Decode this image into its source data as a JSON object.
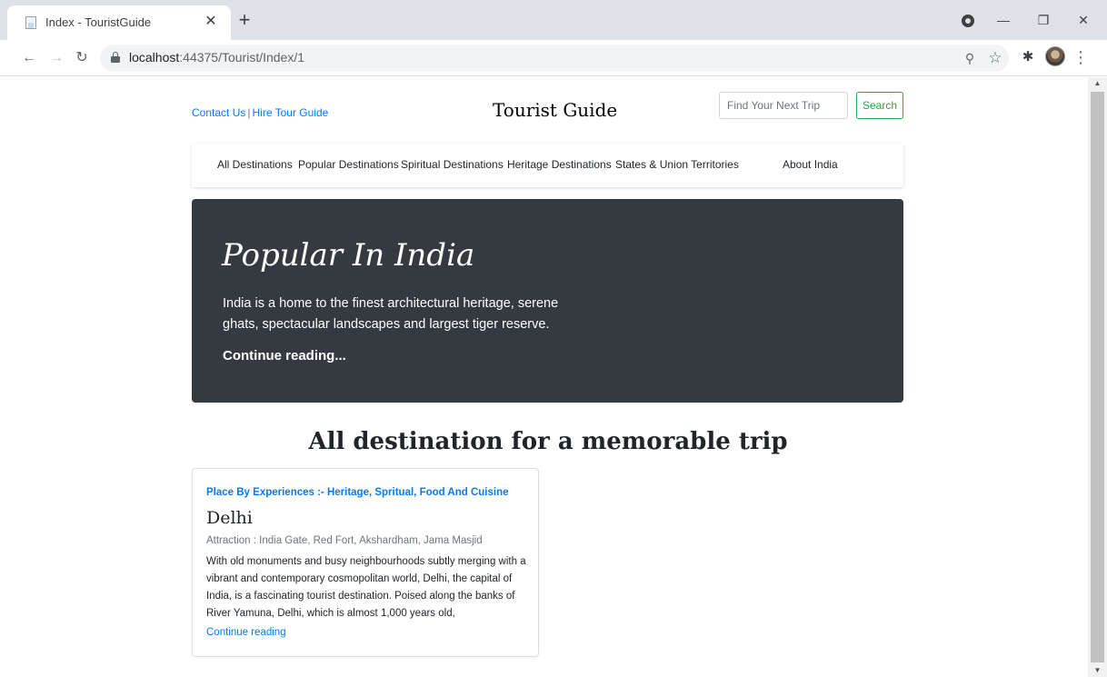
{
  "browser": {
    "tab_title": "Index - TouristGuide",
    "url_host": "localhost",
    "url_path": ":44375/Tourist/Index/1",
    "icons": [
      "page-favicon-icon",
      "close-icon",
      "plus-icon",
      "back-arrow-icon",
      "forward-arrow-icon",
      "reload-icon",
      "lock-icon",
      "zoom-icon",
      "star-icon",
      "puzzle-icon",
      "menu-icon"
    ]
  },
  "header": {
    "contact_link": "Contact Us",
    "separator": "|",
    "hire_link": "Hire Tour Guide",
    "site_title": "Tourist Guide",
    "search_placeholder": "Find Your Next Trip",
    "search_button": "Search"
  },
  "nav": {
    "items": [
      {
        "label": "All Destinations"
      },
      {
        "label": "Popular Destinations"
      },
      {
        "label": "Spiritual Destinations"
      },
      {
        "label": "Heritage Destinations"
      },
      {
        "label": "States & Union Territories"
      },
      {
        "label": "About India"
      }
    ]
  },
  "hero": {
    "title": "Popular In India",
    "lead": "India is a home to the finest architectural heritage, serene ghats, spectacular landscapes and largest tiger reserve.",
    "link": "Continue reading..."
  },
  "section": {
    "title": "All destination for a memorable trip"
  },
  "cards": [
    {
      "category": "Place By Experiences :- Heritage, Spritual, Food And Cuisine",
      "title": "Delhi",
      "attraction": "Attraction : India Gate, Red Fort, Akshardham, Jama Masjid",
      "text": "With old monuments and busy neighbourhoods subtly merging with a vibrant and contemporary cosmopolitan world, Delhi, the capital of India, is a fascinating tourist destination. Poised along the banks of River Yamuna, Delhi, which is almost 1,000 years old,",
      "link": "Continue reading"
    }
  ],
  "colors": {
    "link": "#007bff",
    "search_button": "#28a745",
    "hero_background": "#343a40",
    "chrome_tabstrip": "#dee1e6"
  }
}
